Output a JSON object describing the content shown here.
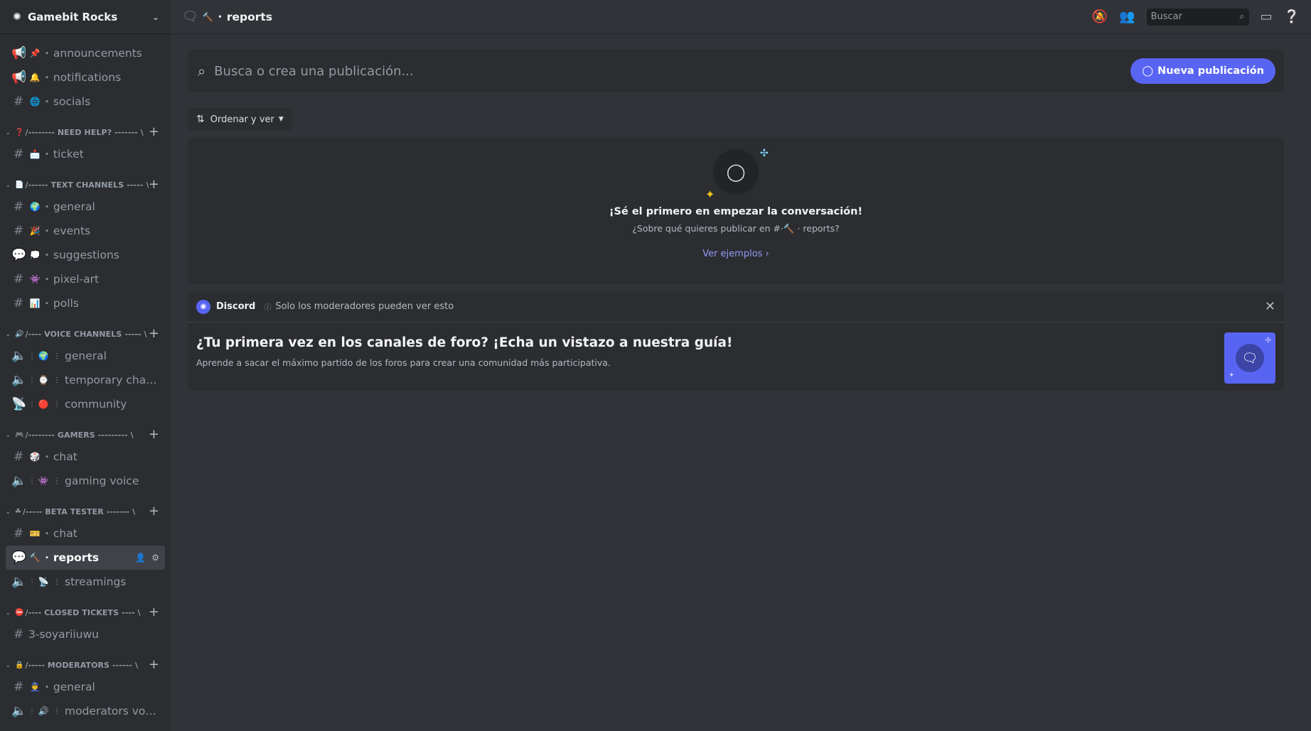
{
  "server": {
    "name": "Gamebit Rocks"
  },
  "sidebar": {
    "top_channels": [
      {
        "icon": "announcement-icon",
        "glyph": "📢",
        "emoji": "📌",
        "name": "announcements"
      },
      {
        "icon": "announcement-icon",
        "glyph": "📢",
        "emoji": "🔔",
        "name": "notifications"
      },
      {
        "icon": "text-channel-icon",
        "glyph": "#",
        "emoji": "🌐",
        "name": "socials"
      }
    ],
    "categories": [
      {
        "emoji": "❓",
        "name": "/-------- NEED HELP? ------- \\",
        "channels": [
          {
            "icon": "text-channel-icon",
            "glyph": "#",
            "emoji": "📩",
            "name": "ticket"
          }
        ]
      },
      {
        "emoji": "📄",
        "name": "/------ TEXT CHANNELS ----- \\",
        "channels": [
          {
            "icon": "text-channel-icon",
            "glyph": "#",
            "emoji": "🌍",
            "name": "general"
          },
          {
            "icon": "text-channel-icon",
            "glyph": "#",
            "emoji": "🎉",
            "name": "events"
          },
          {
            "icon": "forum-channel-icon",
            "glyph": "💬",
            "emoji": "💭",
            "name": "suggestions"
          },
          {
            "icon": "text-channel-icon",
            "glyph": "#",
            "emoji": "👾",
            "name": "pixel-art"
          },
          {
            "icon": "text-channel-icon",
            "glyph": "#",
            "emoji": "📊",
            "name": "polls"
          }
        ]
      },
      {
        "emoji": "🔊",
        "name": "/---- VOICE CHANNELS ----- \\",
        "channels": [
          {
            "icon": "voice-channel-icon",
            "glyph": "🔈",
            "emoji": "🌍",
            "name": "general",
            "voice": true
          },
          {
            "icon": "voice-channel-icon",
            "glyph": "🔈",
            "emoji": "⌚",
            "name": "temporary chan...",
            "voice": true
          },
          {
            "icon": "stage-channel-icon",
            "glyph": "📡",
            "emoji": "🔴",
            "name": "community",
            "voice": true
          }
        ]
      },
      {
        "emoji": "🎮",
        "name": "/-------- GAMERS --------- \\",
        "channels": [
          {
            "icon": "text-channel-icon",
            "glyph": "#",
            "emoji": "🎲",
            "name": "chat"
          },
          {
            "icon": "voice-channel-icon",
            "glyph": "🔈",
            "emoji": "👾",
            "name": "gaming voice",
            "voice": true
          }
        ]
      },
      {
        "emoji": "☘",
        "name": "/----- BETA TESTER ------- \\",
        "channels": [
          {
            "icon": "text-channel-icon",
            "glyph": "#",
            "emoji": "🎫",
            "name": "chat"
          },
          {
            "icon": "forum-channel-icon",
            "glyph": "💬",
            "emoji": "🔨",
            "name": "reports",
            "active": true
          },
          {
            "icon": "voice-channel-icon",
            "glyph": "🔈",
            "emoji": "📡",
            "name": "streamings",
            "voice": true
          }
        ]
      },
      {
        "emoji": "⛔",
        "name": "/---- CLOSED TICKETS ---- \\",
        "channels": [
          {
            "icon": "text-channel-icon",
            "glyph": "#",
            "emoji": "",
            "name": "3-soyariiuwu",
            "plain": true
          }
        ]
      },
      {
        "emoji": "🔒",
        "name": "/----- MODERATORS ------ \\",
        "channels": [
          {
            "icon": "text-channel-icon",
            "glyph": "#",
            "emoji": "👮",
            "name": "general"
          },
          {
            "icon": "voice-channel-icon",
            "glyph": "🔈",
            "emoji": "🔊",
            "name": "moderators voice",
            "voice": true
          }
        ]
      }
    ]
  },
  "topbar": {
    "emoji": "🔨",
    "title": "reports",
    "search_placeholder": "Buscar"
  },
  "forum": {
    "search_placeholder": "Busca o crea una publicación...",
    "new_post_label": "Nueva publicación",
    "sort_label": "Ordenar y ver",
    "empty_title": "¡Sé el primero en empezar la conversación!",
    "empty_sub": "¿Sobre qué quieres publicar en #·🔨 · reports?",
    "examples_link": "Ver ejemplos"
  },
  "notice": {
    "sender": "Discord",
    "visibility": "Solo los moderadores pueden ver esto",
    "title": "¿Tu primera vez en los canales de foro? ¡Echa un vistazo a nuestra guía!",
    "desc": "Aprende a sacar el máximo partido de los foros para crear una comunidad más participativa."
  },
  "colors": {
    "accent": "#5865f2",
    "link": "#949cf7",
    "sidebar_bg": "#2b2d31",
    "main_bg": "#313338"
  }
}
